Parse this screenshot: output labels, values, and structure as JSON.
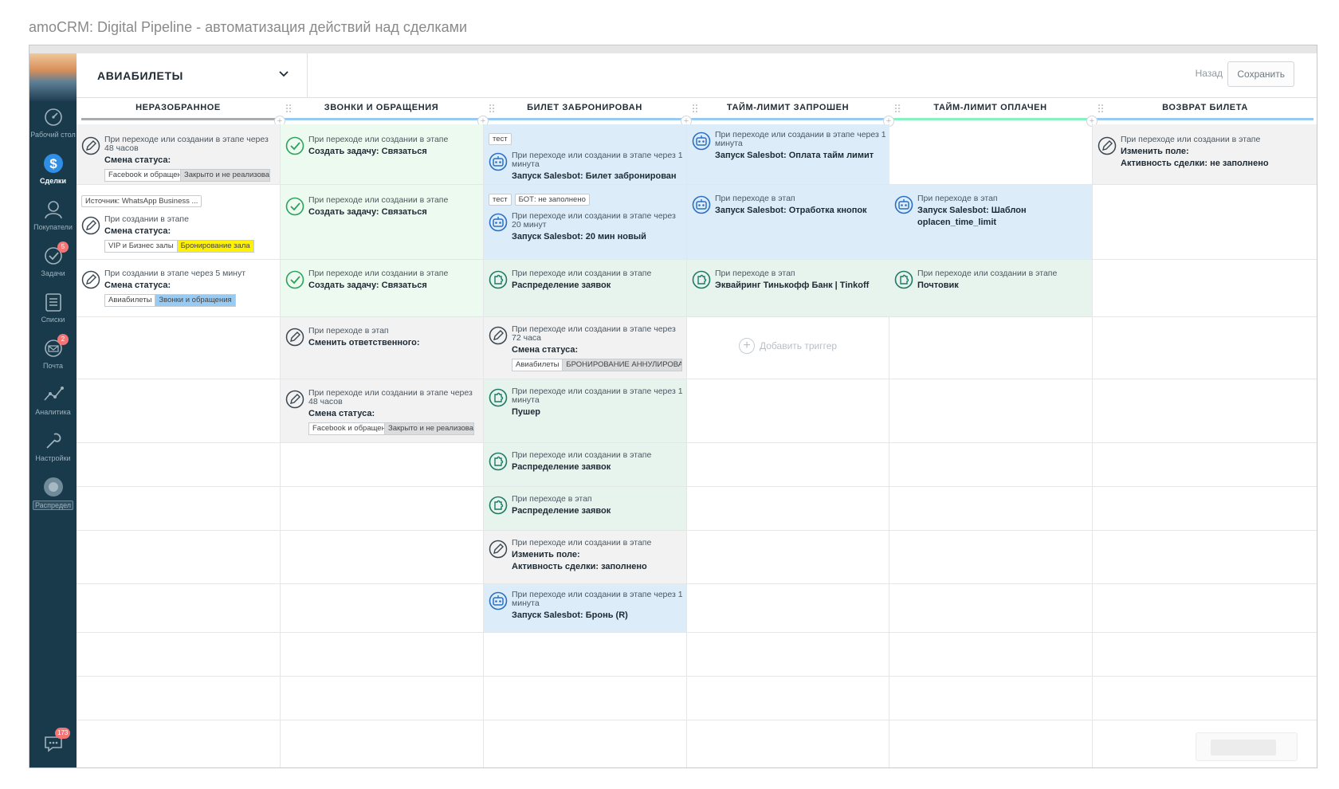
{
  "page_caption": "amoCRM: Digital Pipeline - автоматизация действий над сделками",
  "sidebar": {
    "items": [
      {
        "label": "Рабочий стол",
        "icon": "dashboard-icon"
      },
      {
        "label": "Сделки",
        "icon": "deals-icon"
      },
      {
        "label": "Покупатели",
        "icon": "customers-icon"
      },
      {
        "label": "Задачи",
        "icon": "tasks-icon",
        "badge": "5"
      },
      {
        "label": "Списки",
        "icon": "lists-icon"
      },
      {
        "label": "Почта",
        "icon": "mail-icon",
        "badge": "2"
      },
      {
        "label": "Аналитика",
        "icon": "analytics-icon"
      },
      {
        "label": "Настройки",
        "icon": "settings-icon"
      },
      {
        "label": "Распредел",
        "icon": "distribution-icon"
      }
    ],
    "chat_badge": "173"
  },
  "header": {
    "pipeline_name": "АВИАБИЛЕТЫ",
    "back_label": "Назад",
    "save_label": "Сохранить"
  },
  "columns": [
    {
      "title": "НЕРАЗОБРАННОЕ",
      "color": "#a9adb0"
    },
    {
      "title": "ЗВОНКИ И ОБРАЩЕНИЯ",
      "color": "#98cbf4"
    },
    {
      "title": "БИЛЕТ ЗАБРОНИРОВАН",
      "color": "#98cbf4"
    },
    {
      "title": "ТАЙМ-ЛИМИТ ЗАПРОШЕН",
      "color": "#98cbf4"
    },
    {
      "title": "ТАЙМ-ЛИМИТ ОПЛАЧЕН",
      "color": "#87f2c0"
    },
    {
      "title": "ВОЗВРАТ БИЛЕТА",
      "color": "#98cbf4"
    }
  ],
  "triggers": {
    "c0r0": {
      "text": "При переходе или создании в этапе через 48 часов",
      "action": "Смена статуса:",
      "tags": [
        "Facebook и обращен",
        "Закрыто и не реализова"
      ]
    },
    "c0r1": {
      "chip": "Источник: WhatsApp Business ...",
      "text": "При создании в этапе",
      "action": "Смена статуса:",
      "tags": [
        "VIP и Бизнес залы",
        "Бронирование зала"
      ]
    },
    "c0r2": {
      "text": "При создании в этапе через 5 минут",
      "action": "Смена статуса:",
      "tags": [
        "Авиабилеты",
        "Звонки и обращения"
      ]
    },
    "c1r0": {
      "text": "При переходе или создании в этапе",
      "action": "Создать задачу: Связаться"
    },
    "c1r1": {
      "text": "При переходе или создании в этапе",
      "action": "Создать задачу: Связаться"
    },
    "c1r2": {
      "text": "При переходе или создании в этапе",
      "action": "Создать задачу: Связаться"
    },
    "c1r3": {
      "text": "При переходе в этап",
      "action": "Сменить ответственного:"
    },
    "c1r4": {
      "text": "При переходе или создании в этапе через 48 часов",
      "action": "Смена статуса:",
      "tags": [
        "Facebook и обращен",
        "Закрыто и не реализова"
      ]
    },
    "c2r0": {
      "chips": [
        "тест"
      ],
      "text": "При переходе или создании в этапе через 1 минута",
      "action": "Запуск Salesbot: Билет забронирован (R)"
    },
    "c2r1": {
      "chips": [
        "тест",
        "БОТ: не заполнено"
      ],
      "text": "При переходе или создании в этапе через 20 минут",
      "action": "Запуск Salesbot: 20 мин новый"
    },
    "c2r2": {
      "text": "При переходе или создании в этапе",
      "action": "Распределение заявок"
    },
    "c2r3": {
      "text": "При переходе или создании в этапе через 72 часа",
      "action": "Смена статуса:",
      "tags": [
        "Авиабилеты",
        "БРОНИРОВАНИЕ АННУЛИРОВАН"
      ]
    },
    "c2r4": {
      "text": "При переходе или создании в этапе через 1 минута",
      "action": "Пушер"
    },
    "c2r5": {
      "text": "При переходе или создании в этапе",
      "action": "Распределение заявок"
    },
    "c2r6": {
      "text": "При переходе в этап",
      "action": "Распределение заявок"
    },
    "c2r7": {
      "text": "При переходе или создании в этапе",
      "action": "Изменить поле:",
      "action2": "Активность сделки: заполнено"
    },
    "c2r8": {
      "text": "При переходе или создании в этапе через 1 минута",
      "action": "Запуск Salesbot: Бронь (R)"
    },
    "c3r0": {
      "text": "При переходе или создании в этапе через 1 минута",
      "action": "Запуск Salesbot: Оплата тайм лимит"
    },
    "c3r1": {
      "text": "При переходе в этап",
      "action": "Запуск Salesbot: Отработка кнопок"
    },
    "c3r2": {
      "text": "При переходе в этап",
      "action": "Эквайринг Тинькофф Банк | Tinkoff"
    },
    "c4r1": {
      "text": "При переходе в этап",
      "action": "Запуск Salesbot: Шаблон oplacen_time_limit"
    },
    "c4r2": {
      "text": "При переходе или создании в этапе",
      "action": "Почтовик"
    },
    "c5r0": {
      "text": "При переходе или создании в этапе",
      "action": "Изменить поле:",
      "action2": "Активность сделки: не заполнено"
    }
  },
  "add_trigger_label": "Добавить триггер"
}
